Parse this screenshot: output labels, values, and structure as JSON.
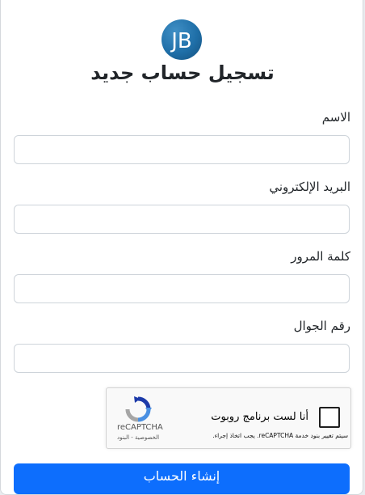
{
  "header": {
    "logo_text": "JB",
    "title": "تسجيل حساب جديد"
  },
  "form": {
    "name_label": "الاسم",
    "email_label": "البريد الإلكتروني",
    "password_label": "كلمة المرور",
    "phone_label": "رقم الجوال",
    "name_value": "",
    "email_value": "",
    "password_value": "",
    "phone_value": ""
  },
  "recaptcha": {
    "label": "أنا لست برنامج روبوت",
    "terms": "سيتم تغيير بنود خدمة reCAPTCHA. يجب اتخاذ إجراء.",
    "brand": "reCAPTCHA",
    "links": "الخصوصية - البنود",
    "icon": "recaptcha-logo-icon",
    "checked": false
  },
  "actions": {
    "submit_label": "إنشاء الحساب"
  },
  "colors": {
    "primary": "#0d6efd",
    "logo_blue": "#1f6fa8"
  }
}
